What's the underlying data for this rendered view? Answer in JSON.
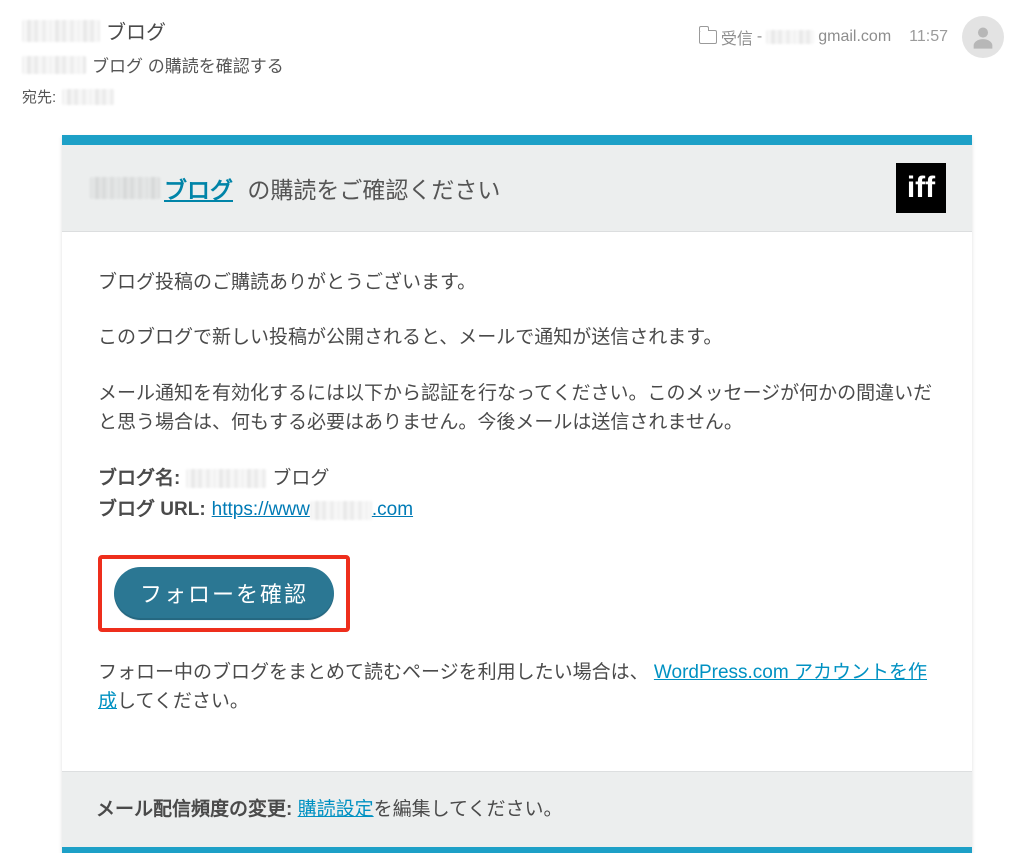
{
  "mail": {
    "sender_suffix": "ブログ",
    "subject_suffix": "ブログ の購読を確認する",
    "recipient_label": "宛先:",
    "folder_label": "受信",
    "account_suffix": "gmail.com",
    "time": "11:57"
  },
  "card": {
    "blog_link_suffix": "ブログ",
    "title_suffix": "の購読をご確認ください",
    "logo_text": "iff",
    "p1": "ブログ投稿のご購読ありがとうございます。",
    "p2": "このブログで新しい投稿が公開されると、メールで通知が送信されます。",
    "p3": "メール通知を有効化するには以下から認証を行なってください。このメッセージが何かの間違いだと思う場合は、何もする必要はありません。今後メールは送信されません。",
    "blog_name_label": "ブログ名:",
    "blog_name_suffix": "ブログ",
    "blog_url_label": "ブログ URL:",
    "blog_url_prefix": "https://www",
    "blog_url_suffix": ".com",
    "cta_label": "フォローを確認",
    "follow_note_before": "フォロー中のブログをまとめて読むページを利用したい場合は、",
    "follow_note_link": "WordPress.com アカウントを作成",
    "follow_note_after": "してください。"
  },
  "footer": {
    "label": "メール配信頻度の変更:",
    "link": "購読設定",
    "after": "を編集してください。"
  }
}
